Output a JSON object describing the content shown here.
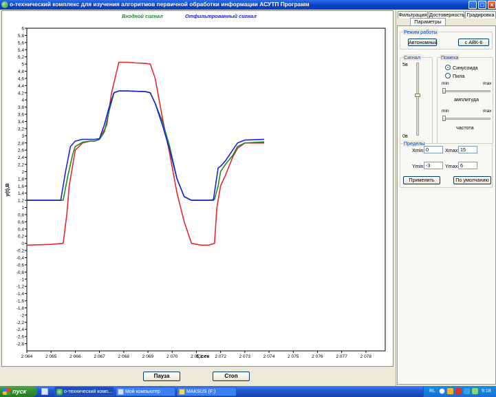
{
  "window": {
    "title": "о-технический комплекс  для изучения алгоритмов первичной обработки информации АСУТП     Программ",
    "min_label": "_",
    "max_label": "□",
    "close_label": "×"
  },
  "legend": {
    "input": "Входной сигнал",
    "filtered": "Отфильтрованный сигнал"
  },
  "chart_data": {
    "type": "line",
    "xlabel": "t, сек",
    "ylabel": "y(t),В",
    "xlim": [
      2064,
      2078.8
    ],
    "ylim": [
      -3,
      6
    ],
    "x_ticks": [
      2064,
      2065,
      2066,
      2067,
      2068,
      2069,
      2070,
      2071,
      2072,
      2073,
      2074,
      2075,
      2076,
      2077,
      2078
    ],
    "x_tick_labels": [
      "2 064",
      "2 065",
      "2 066",
      "2 067",
      "2 068",
      "2 069",
      "2 070",
      "2 071",
      "2 072",
      "2 073",
      "2 074",
      "2 075",
      "2 076",
      "2 077",
      "2 078"
    ],
    "y_ticks": [
      6,
      5.8,
      5.6,
      5.4,
      5.2,
      5,
      4.8,
      4.6,
      4.4,
      4.2,
      4,
      3.8,
      3.6,
      3.4,
      3.2,
      3,
      2.8,
      2.6,
      2.4,
      2.2,
      2,
      1.8,
      1.6,
      1.4,
      1.2,
      1,
      0.8,
      0.6,
      0.4,
      0.2,
      0,
      -0.2,
      -0.4,
      -0.6,
      -0.8,
      -1,
      -1.2,
      -1.4,
      -1.6,
      -1.8,
      -2,
      -2.2,
      -2.4,
      -2.6,
      -2.8
    ],
    "y_tick_labels": [
      "6",
      "5,8",
      "5,6",
      "5,4",
      "5,2",
      "5",
      "4,8",
      "4,6",
      "4,4",
      "4,2",
      "4",
      "3,8",
      "3,6",
      "3,4",
      "3,2",
      "3",
      "2,8",
      "2,6",
      "2,4",
      "2,2",
      "2",
      "1,8",
      "1,6",
      "1,4",
      "1,2",
      "1",
      "0,8",
      "0,6",
      "0,4",
      "0,2",
      "0",
      "-0,2",
      "-0,4",
      "-0,6",
      "-0,8",
      "-1",
      "-1,2",
      "-1,4",
      "-1,6",
      "-1,8",
      "-2",
      "-2,2",
      "-2,4",
      "-2,6",
      "-2,8"
    ],
    "grid": false,
    "series": [
      {
        "name": "red",
        "color": "#e8262a",
        "x": [
          2064.0,
          2065.0,
          2065.5,
          2065.65,
          2065.75,
          2065.9,
          2066.0,
          2066.3,
          2066.6,
          2066.8,
          2067.0,
          2067.3,
          2067.5,
          2067.8,
          2068.2,
          2068.5,
          2068.9,
          2069.1,
          2069.3,
          2069.6,
          2069.9,
          2070.2,
          2070.5,
          2070.8,
          2071.2,
          2071.5,
          2071.75,
          2071.85,
          2072.0,
          2072.2,
          2072.5,
          2072.7,
          2073.0,
          2073.8
        ],
        "y": [
          -0.05,
          -0.03,
          0.0,
          0.8,
          1.6,
          2.2,
          2.6,
          2.8,
          2.85,
          2.85,
          2.9,
          3.3,
          4.2,
          5.05,
          5.05,
          5.03,
          5.02,
          5.0,
          4.6,
          3.5,
          2.5,
          1.4,
          0.6,
          0.0,
          -0.05,
          -0.05,
          0.0,
          1.0,
          1.6,
          1.9,
          2.4,
          2.65,
          2.8,
          2.8
        ]
      },
      {
        "name": "green",
        "color": "#1a8a2a",
        "x": [
          2064.0,
          2065.0,
          2065.5,
          2065.7,
          2065.9,
          2066.0,
          2066.3,
          2066.6,
          2066.8,
          2067.0,
          2067.2,
          2067.4,
          2067.6,
          2067.8,
          2068.2,
          2068.5,
          2068.9,
          2069.1,
          2069.3,
          2069.6,
          2069.9,
          2070.2,
          2070.5,
          2070.8,
          2071.2,
          2071.5,
          2071.75,
          2071.9,
          2072.0,
          2072.2,
          2072.5,
          2072.7,
          2073.0,
          2073.8
        ],
        "y": [
          1.2,
          1.2,
          1.2,
          1.9,
          2.5,
          2.7,
          2.82,
          2.85,
          2.85,
          2.9,
          3.1,
          3.7,
          4.2,
          4.25,
          4.25,
          4.24,
          4.23,
          4.2,
          3.9,
          3.4,
          2.7,
          1.8,
          1.3,
          1.2,
          1.2,
          1.2,
          1.22,
          1.6,
          2.0,
          2.2,
          2.45,
          2.7,
          2.8,
          2.83
        ]
      },
      {
        "name": "blue",
        "color": "#1a20e0",
        "x": [
          2064.0,
          2065.0,
          2065.4,
          2065.6,
          2065.8,
          2066.0,
          2066.3,
          2066.6,
          2066.8,
          2067.0,
          2067.2,
          2067.4,
          2067.6,
          2067.8,
          2068.2,
          2068.5,
          2068.9,
          2069.1,
          2069.3,
          2069.6,
          2069.9,
          2070.2,
          2070.5,
          2070.8,
          2071.2,
          2071.5,
          2071.7,
          2071.9,
          2072.0,
          2072.2,
          2072.5,
          2072.7,
          2073.0,
          2073.8
        ],
        "y": [
          1.2,
          1.2,
          1.2,
          2.0,
          2.7,
          2.85,
          2.9,
          2.9,
          2.9,
          2.92,
          3.3,
          3.8,
          4.2,
          4.25,
          4.25,
          4.24,
          4.23,
          4.2,
          3.9,
          3.3,
          2.6,
          1.8,
          1.3,
          1.2,
          1.2,
          1.2,
          1.2,
          2.1,
          2.15,
          2.3,
          2.6,
          2.8,
          2.88,
          2.9
        ]
      }
    ]
  },
  "buttons": {
    "pause": "Пауза",
    "stop": "Стоп"
  },
  "tabs": [
    {
      "label": "Фильтрация"
    },
    {
      "label": "Достоверность"
    },
    {
      "label": "Градировка"
    },
    {
      "label": "Параметры"
    }
  ],
  "mode_group": {
    "title": "Режим работы",
    "autonomous": "Автономный",
    "abk": "с АВК-6"
  },
  "signal_group": {
    "title": "Сигнал",
    "top": "5в",
    "bottom": "0в",
    "level": 0.55
  },
  "noise_group": {
    "title": "Помеха",
    "options": [
      {
        "label": "Синусоида",
        "selected": true
      },
      {
        "label": "Пила",
        "selected": false
      }
    ],
    "amp": {
      "min": "min",
      "max": "max",
      "label": "амплитуда",
      "value": 0.0
    },
    "freq": {
      "min": "min",
      "max": "max",
      "label": "частота",
      "value": 0.0
    }
  },
  "limits_group": {
    "title": "Пределы",
    "xmin_label": "Xmin",
    "xmin": "0",
    "xmax_label": "Xmax",
    "xmax": "15",
    "ymin_label": "Ymin",
    "ymin": "-3",
    "ymax_label": "Ymax",
    "ymax": "6",
    "apply": "Применить",
    "default": "По умолчанию"
  },
  "taskbar": {
    "start": "пуск",
    "items": [
      {
        "label": "о-технический комп..."
      },
      {
        "label": "Мой компьютер"
      },
      {
        "label": "MAKSUS (F:)"
      }
    ],
    "lang": "RL",
    "time": "9:18"
  },
  "colors": {
    "xp_blue": "#0a3fc4",
    "input_green": "#1a8a2a",
    "filtered_blue": "#1a20e0",
    "red": "#e8262a"
  }
}
